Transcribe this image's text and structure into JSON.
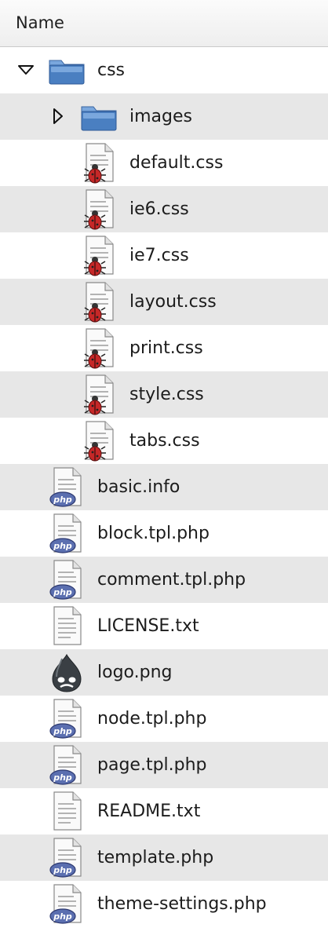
{
  "header": {
    "column_name": "Name"
  },
  "rows": [
    {
      "name": "css",
      "icon": "folder-icon",
      "indent": 0,
      "expander": "open"
    },
    {
      "name": "images",
      "icon": "folder-icon",
      "indent": 1,
      "expander": "closed"
    },
    {
      "name": "default.css",
      "icon": "css-file-icon",
      "indent": 1,
      "expander": "none"
    },
    {
      "name": "ie6.css",
      "icon": "css-file-icon",
      "indent": 1,
      "expander": "none"
    },
    {
      "name": "ie7.css",
      "icon": "css-file-icon",
      "indent": 1,
      "expander": "none"
    },
    {
      "name": "layout.css",
      "icon": "css-file-icon",
      "indent": 1,
      "expander": "none"
    },
    {
      "name": "print.css",
      "icon": "css-file-icon",
      "indent": 1,
      "expander": "none"
    },
    {
      "name": "style.css",
      "icon": "css-file-icon",
      "indent": 1,
      "expander": "none"
    },
    {
      "name": "tabs.css",
      "icon": "css-file-icon",
      "indent": 1,
      "expander": "none"
    },
    {
      "name": "basic.info",
      "icon": "php-file-icon",
      "indent": 0,
      "expander": "none"
    },
    {
      "name": "block.tpl.php",
      "icon": "php-file-icon",
      "indent": 0,
      "expander": "none"
    },
    {
      "name": "comment.tpl.php",
      "icon": "php-file-icon",
      "indent": 0,
      "expander": "none"
    },
    {
      "name": "LICENSE.txt",
      "icon": "text-file-icon",
      "indent": 0,
      "expander": "none"
    },
    {
      "name": "logo.png",
      "icon": "drupal-logo-icon",
      "indent": 0,
      "expander": "none"
    },
    {
      "name": "node.tpl.php",
      "icon": "php-file-icon",
      "indent": 0,
      "expander": "none"
    },
    {
      "name": "page.tpl.php",
      "icon": "php-file-icon",
      "indent": 0,
      "expander": "none"
    },
    {
      "name": "README.txt",
      "icon": "text-file-icon",
      "indent": 0,
      "expander": "none"
    },
    {
      "name": "template.php",
      "icon": "php-file-icon",
      "indent": 0,
      "expander": "none"
    },
    {
      "name": "theme-settings.php",
      "icon": "php-file-icon",
      "indent": 0,
      "expander": "none"
    }
  ],
  "colors": {
    "row_alternate": "#e7e7e7",
    "folder_blue": "#4a7fc1",
    "php_badge": "#5b6fb0",
    "css_bug": "#c62828"
  }
}
